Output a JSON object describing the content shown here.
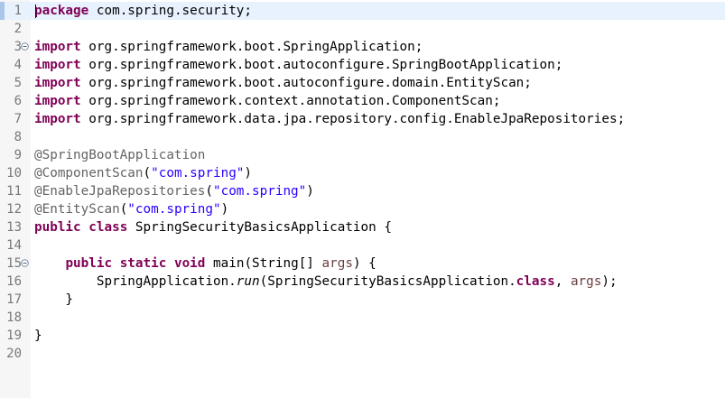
{
  "lines": [
    {
      "n": "1",
      "parts": [
        [
          "kw",
          "package"
        ],
        [
          "t",
          " com.spring.security;"
        ]
      ]
    },
    {
      "n": "2",
      "parts": []
    },
    {
      "n": "3",
      "fold": true,
      "parts": [
        [
          "kw",
          "import"
        ],
        [
          "t",
          " org.springframework.boot.SpringApplication;"
        ]
      ]
    },
    {
      "n": "4",
      "parts": [
        [
          "kw",
          "import"
        ],
        [
          "t",
          " org.springframework.boot.autoconfigure.SpringBootApplication;"
        ]
      ]
    },
    {
      "n": "5",
      "parts": [
        [
          "kw",
          "import"
        ],
        [
          "t",
          " org.springframework.boot.autoconfigure.domain.EntityScan;"
        ]
      ]
    },
    {
      "n": "6",
      "parts": [
        [
          "kw",
          "import"
        ],
        [
          "t",
          " org.springframework.context.annotation.ComponentScan;"
        ]
      ]
    },
    {
      "n": "7",
      "parts": [
        [
          "kw",
          "import"
        ],
        [
          "t",
          " org.springframework.data.jpa.repository.config.EnableJpaRepositories;"
        ]
      ]
    },
    {
      "n": "8",
      "parts": []
    },
    {
      "n": "9",
      "parts": [
        [
          "ann",
          "@SpringBootApplication"
        ]
      ]
    },
    {
      "n": "10",
      "parts": [
        [
          "ann",
          "@ComponentScan"
        ],
        [
          "t",
          "("
        ],
        [
          "str",
          "\"com.spring\""
        ],
        [
          "t",
          ")"
        ]
      ]
    },
    {
      "n": "11",
      "parts": [
        [
          "ann",
          "@EnableJpaRepositories"
        ],
        [
          "t",
          "("
        ],
        [
          "str",
          "\"com.spring\""
        ],
        [
          "t",
          ")"
        ]
      ]
    },
    {
      "n": "12",
      "parts": [
        [
          "ann",
          "@EntityScan"
        ],
        [
          "t",
          "("
        ],
        [
          "str",
          "\"com.spring\""
        ],
        [
          "t",
          ")"
        ]
      ]
    },
    {
      "n": "13",
      "parts": [
        [
          "kw",
          "public"
        ],
        [
          "t",
          " "
        ],
        [
          "kw",
          "class"
        ],
        [
          "t",
          " SpringSecurityBasicsApplication {"
        ]
      ]
    },
    {
      "n": "14",
      "parts": []
    },
    {
      "n": "15",
      "fold": true,
      "parts": [
        [
          "t",
          "    "
        ],
        [
          "kw",
          "public"
        ],
        [
          "t",
          " "
        ],
        [
          "kw",
          "static"
        ],
        [
          "t",
          " "
        ],
        [
          "kw",
          "void"
        ],
        [
          "t",
          " main(String[] "
        ],
        [
          "param",
          "args"
        ],
        [
          "t",
          ") {"
        ]
      ]
    },
    {
      "n": "16",
      "parts": [
        [
          "t",
          "        SpringApplication."
        ],
        [
          "italic",
          "run"
        ],
        [
          "t",
          "(SpringSecurityBasicsApplication."
        ],
        [
          "kw",
          "class"
        ],
        [
          "t",
          ", "
        ],
        [
          "param",
          "args"
        ],
        [
          "t",
          ");"
        ]
      ]
    },
    {
      "n": "17",
      "parts": [
        [
          "t",
          "    }"
        ]
      ]
    },
    {
      "n": "18",
      "parts": []
    },
    {
      "n": "19",
      "parts": [
        [
          "t",
          "}"
        ]
      ]
    },
    {
      "n": "20",
      "parts": []
    }
  ]
}
